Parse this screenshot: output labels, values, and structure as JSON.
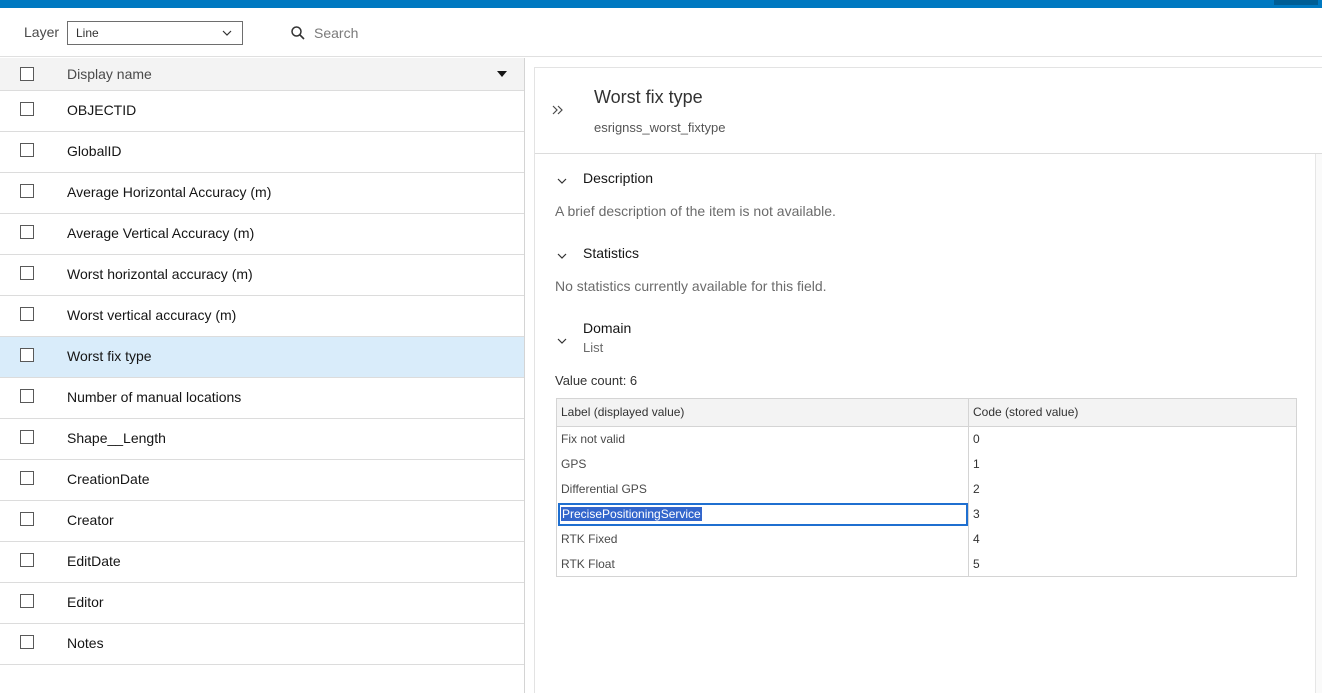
{
  "toolbar": {
    "layer_label": "Layer",
    "layer_value": "Line",
    "search_placeholder": "Search"
  },
  "field_list": {
    "header": "Display name",
    "items": [
      {
        "label": "OBJECTID",
        "selected": false
      },
      {
        "label": "GlobalID",
        "selected": false
      },
      {
        "label": "Average Horizontal Accuracy (m)",
        "selected": false
      },
      {
        "label": "Average Vertical Accuracy (m)",
        "selected": false
      },
      {
        "label": "Worst horizontal accuracy (m)",
        "selected": false
      },
      {
        "label": "Worst vertical accuracy (m)",
        "selected": false
      },
      {
        "label": "Worst fix type",
        "selected": true
      },
      {
        "label": "Number of manual locations",
        "selected": false
      },
      {
        "label": "Shape__Length",
        "selected": false
      },
      {
        "label": "CreationDate",
        "selected": false
      },
      {
        "label": "Creator",
        "selected": false
      },
      {
        "label": "EditDate",
        "selected": false
      },
      {
        "label": "Editor",
        "selected": false
      },
      {
        "label": "Notes",
        "selected": false
      }
    ]
  },
  "details": {
    "title": "Worst fix type",
    "field_name": "esrignss_worst_fixtype",
    "description": {
      "heading": "Description",
      "text": "A brief description of the item is not available."
    },
    "statistics": {
      "heading": "Statistics",
      "text": "No statistics currently available for this field."
    },
    "domain": {
      "heading": "Domain",
      "type": "List",
      "value_count": "Value count: 6",
      "columns": [
        "Label (displayed value)",
        "Code (stored value)"
      ],
      "rows": [
        {
          "label": "Fix not valid",
          "code": "0"
        },
        {
          "label": "GPS",
          "code": "1"
        },
        {
          "label": "Differential GPS",
          "code": "2"
        },
        {
          "label": "PrecisePositioningService",
          "code": "3",
          "selected": true
        },
        {
          "label": "RTK Fixed",
          "code": "4"
        },
        {
          "label": "RTK Float",
          "code": "5"
        }
      ]
    }
  },
  "colors": {
    "accent": "#0079c1",
    "selected_row": "#d9ecfa",
    "text_selection": "#3366cc"
  }
}
